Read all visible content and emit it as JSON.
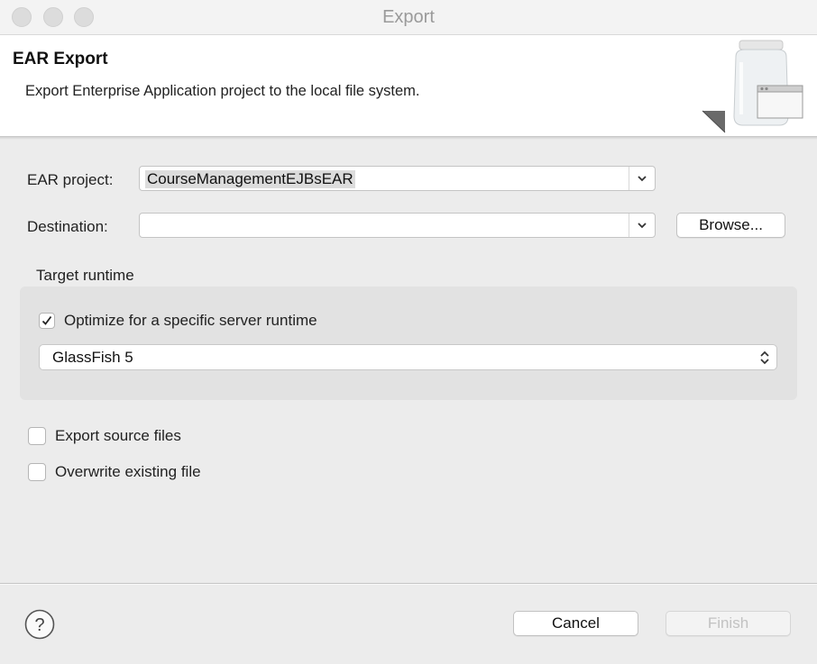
{
  "window": {
    "title": "Export"
  },
  "banner": {
    "title": "EAR Export",
    "description": "Export Enterprise Application project to the local file system."
  },
  "form": {
    "ear_project": {
      "label": "EAR project:",
      "value": "CourseManagementEJBsEAR"
    },
    "destination": {
      "label": "Destination:",
      "value": ""
    },
    "browse_label": "Browse...",
    "target_runtime": {
      "group_label": "Target runtime",
      "optimize_label": "Optimize for a specific server runtime",
      "optimize_checked": true,
      "selected_runtime": "GlassFish 5"
    },
    "export_source": {
      "label": "Export source files",
      "checked": false
    },
    "overwrite": {
      "label": "Overwrite existing file",
      "checked": false
    }
  },
  "footer": {
    "help_icon": "question-mark-circle-icon",
    "cancel_label": "Cancel",
    "finish_label": "Finish",
    "finish_enabled": false
  }
}
